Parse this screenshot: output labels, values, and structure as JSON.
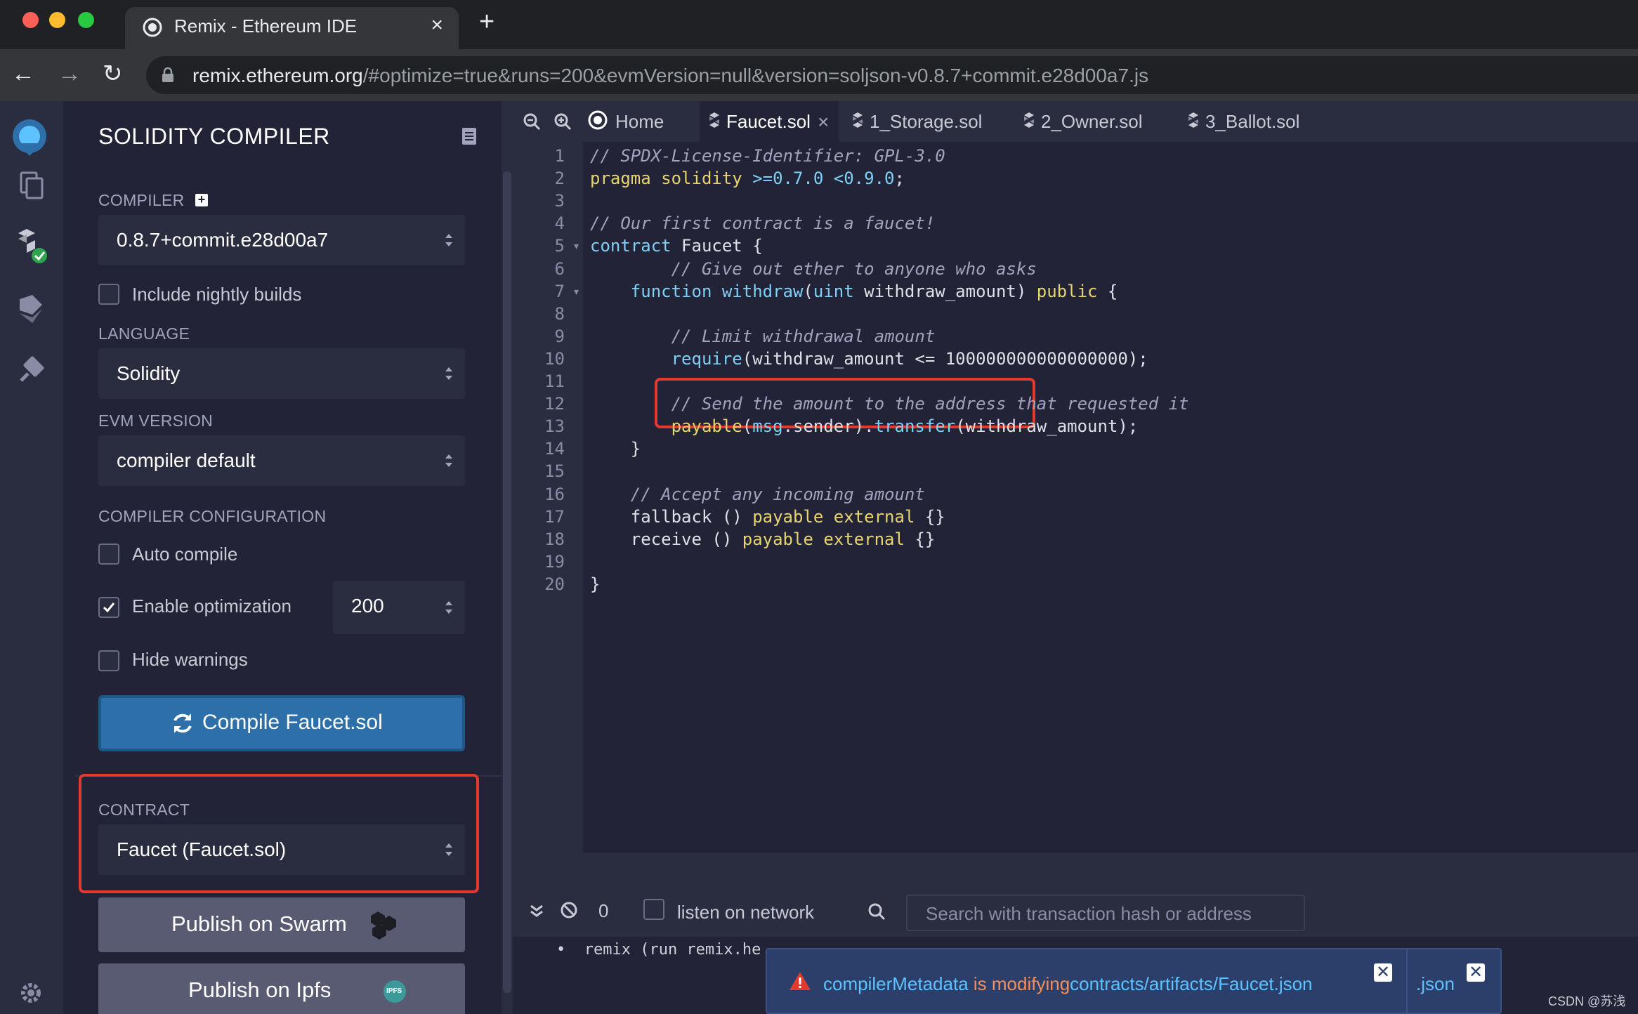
{
  "browser": {
    "tab_title": "Remix - Ethereum IDE",
    "url_host": "remix.ethereum.org",
    "url_rest": "/#optimize=true&runs=200&evmVersion=null&version=soljson-v0.8.7+commit.e28d00a7.js"
  },
  "sidepanel": {
    "title": "SOLIDITY COMPILER",
    "compiler_label": "COMPILER",
    "compiler_version": "0.8.7+commit.e28d00a7",
    "nightly_label": "Include nightly builds",
    "nightly_checked": false,
    "language_label": "LANGUAGE",
    "language_value": "Solidity",
    "evm_label": "EVM VERSION",
    "evm_value": "compiler default",
    "config_label": "COMPILER CONFIGURATION",
    "auto_compile_label": "Auto compile",
    "auto_compile_checked": false,
    "optimization_label": "Enable optimization",
    "optimization_checked": true,
    "runs_value": "200",
    "hide_warnings_label": "Hide warnings",
    "hide_warnings_checked": false,
    "compile_button": "Compile Faucet.sol",
    "contract_label": "CONTRACT",
    "contract_value": "Faucet (Faucet.sol)",
    "publish_swarm": "Publish on Swarm",
    "publish_ipfs": "Publish on Ipfs",
    "ipfs_badge": "IPFS"
  },
  "editor": {
    "tabs": [
      {
        "label": "Home"
      },
      {
        "label": "Faucet.sol",
        "active": true
      },
      {
        "label": "1_Storage.sol"
      },
      {
        "label": "2_Owner.sol"
      },
      {
        "label": "3_Ballot.sol"
      }
    ],
    "active_line": 13,
    "lines": [
      {
        "n": "1",
        "fold": "",
        "segs": [
          {
            "t": "// SPDX-License-Identifier: GPL-3.0",
            "c": "c-com"
          }
        ]
      },
      {
        "n": "2",
        "fold": "",
        "segs": [
          {
            "t": "pragma solidity ",
            "c": "c-kw"
          },
          {
            "t": ">=0.7.0 <0.9.0",
            "c": "c-num"
          },
          {
            "t": ";",
            "c": "c-plain"
          }
        ]
      },
      {
        "n": "3",
        "fold": "",
        "segs": []
      },
      {
        "n": "4",
        "fold": "",
        "segs": [
          {
            "t": "// Our first contract is a faucet!",
            "c": "c-com"
          }
        ]
      },
      {
        "n": "5",
        "fold": "▾",
        "segs": [
          {
            "t": "contract",
            "c": "c-fn"
          },
          {
            "t": " Faucet {",
            "c": "c-plain"
          }
        ]
      },
      {
        "n": "6",
        "fold": "",
        "segs": [
          {
            "t": "        // Give out ether to anyone who asks",
            "c": "c-com"
          }
        ]
      },
      {
        "n": "7",
        "fold": "▾",
        "segs": [
          {
            "t": "    ",
            "c": "c-plain"
          },
          {
            "t": "function",
            "c": "c-fn"
          },
          {
            "t": " ",
            "c": "c-plain"
          },
          {
            "t": "withdraw",
            "c": "c-fn"
          },
          {
            "t": "(",
            "c": "c-plain"
          },
          {
            "t": "uint",
            "c": "c-fn"
          },
          {
            "t": " withdraw_amount) ",
            "c": "c-plain"
          },
          {
            "t": "public",
            "c": "c-kw"
          },
          {
            "t": " {",
            "c": "c-plain"
          }
        ]
      },
      {
        "n": "8",
        "fold": "",
        "segs": []
      },
      {
        "n": "9",
        "fold": "",
        "segs": [
          {
            "t": "        // Limit withdrawal amount",
            "c": "c-com"
          }
        ]
      },
      {
        "n": "10",
        "fold": "",
        "segs": [
          {
            "t": "        ",
            "c": "c-plain"
          },
          {
            "t": "require",
            "c": "c-fn"
          },
          {
            "t": "(withdraw_amount <= 100000000000000000);",
            "c": "c-plain"
          }
        ]
      },
      {
        "n": "11",
        "fold": "",
        "segs": []
      },
      {
        "n": "12",
        "fold": "",
        "segs": [
          {
            "t": "        // Send the amount to the address that requested it",
            "c": "c-com"
          }
        ]
      },
      {
        "n": "13",
        "fold": "",
        "segs": [
          {
            "t": "        ",
            "c": "c-plain"
          },
          {
            "t": "payable",
            "c": "c-kw"
          },
          {
            "t": "(",
            "c": "c-plain"
          },
          {
            "t": "msg",
            "c": "c-fn"
          },
          {
            "t": ".sender).",
            "c": "c-plain"
          },
          {
            "t": "transfer",
            "c": "c-fn"
          },
          {
            "t": "(withdraw_amount);",
            "c": "c-plain"
          }
        ]
      },
      {
        "n": "14",
        "fold": "",
        "segs": [
          {
            "t": "    }",
            "c": "c-plain"
          }
        ]
      },
      {
        "n": "15",
        "fold": "",
        "segs": []
      },
      {
        "n": "16",
        "fold": "",
        "segs": [
          {
            "t": "    // Accept any incoming amount",
            "c": "c-com"
          }
        ]
      },
      {
        "n": "17",
        "fold": "",
        "segs": [
          {
            "t": "    fallback () ",
            "c": "c-plain"
          },
          {
            "t": "payable",
            "c": "c-kw"
          },
          {
            "t": " ",
            "c": "c-plain"
          },
          {
            "t": "external",
            "c": "c-kw"
          },
          {
            "t": " {}",
            "c": "c-plain"
          }
        ]
      },
      {
        "n": "18",
        "fold": "",
        "segs": [
          {
            "t": "    receive () ",
            "c": "c-plain"
          },
          {
            "t": "payable",
            "c": "c-kw"
          },
          {
            "t": " ",
            "c": "c-plain"
          },
          {
            "t": "external",
            "c": "c-kw"
          },
          {
            "t": " {}",
            "c": "c-plain"
          }
        ]
      },
      {
        "n": "19",
        "fold": "",
        "segs": []
      },
      {
        "n": "20",
        "fold": "",
        "segs": [
          {
            "t": "}",
            "c": "c-plain"
          }
        ]
      }
    ]
  },
  "terminal": {
    "count": "0",
    "listen_label": "listen on network",
    "search_placeholder": "Search with transaction hash or address",
    "log_line": "•  remix (run remix.he"
  },
  "toast": {
    "part1": "compilerMetadata",
    "part2": " is modifying",
    "part3": "contracts/artifacts/Faucet.json",
    "json_tail": ".json",
    "close_glyph": "✕"
  },
  "watermark": "CSDN @苏浅",
  "colors": {
    "highlight": "#e23b2e",
    "compile_button": "#2d6fa8",
    "accent_blue": "#5dc2ff"
  }
}
